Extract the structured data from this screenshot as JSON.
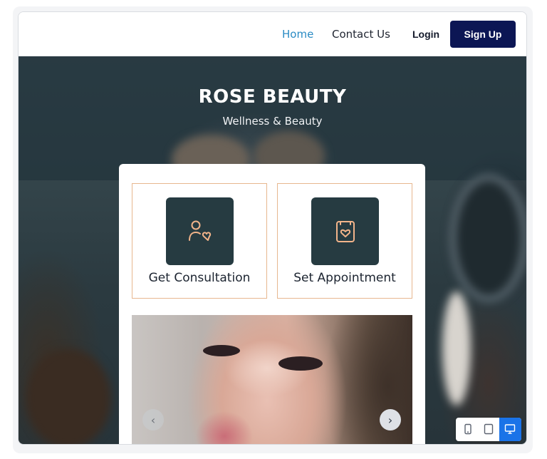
{
  "nav": {
    "home": "Home",
    "contact": "Contact Us",
    "login": "Login",
    "signup": "Sign Up"
  },
  "hero": {
    "title": "ROSE BEAUTY",
    "subtitle": "Wellness & Beauty"
  },
  "services": [
    {
      "label": "Get Consultation",
      "icon": "user-heart-icon"
    },
    {
      "label": "Set Appointment",
      "icon": "calendar-heart-icon"
    }
  ],
  "carousel": {
    "prev_icon": "‹",
    "next_icon": "›",
    "prev_icon_name": "chevron-left-icon",
    "next_icon_name": "chevron-right-icon"
  },
  "device_toggle": {
    "options": [
      "mobile-icon",
      "tablet-icon",
      "desktop-icon"
    ],
    "selected": "desktop-icon"
  },
  "colors": {
    "primary_button": "#0c1654",
    "nav_active": "#2a8bc4",
    "card_border": "#e7b78f",
    "icon_box": "#263b41",
    "icon_stroke": "#f2b48a",
    "device_active": "#1a73e8"
  }
}
